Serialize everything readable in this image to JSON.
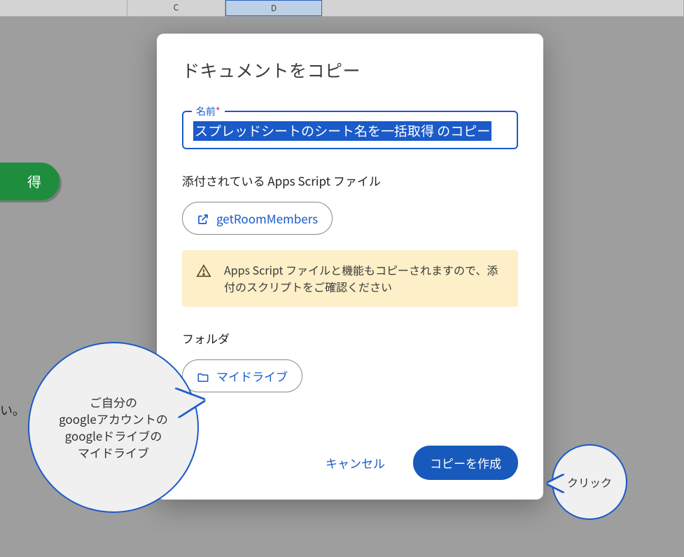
{
  "columns": {
    "c": "C",
    "d": "D"
  },
  "green_button_label": "得",
  "trail_text": "い。",
  "dialog": {
    "title": "ドキュメントをコピー",
    "name_label": "名前",
    "name_required_mark": "*",
    "name_value": "スプレッドシートのシート名を一括取得 のコピー",
    "apps_script_label": "添付されている Apps Script ファイル",
    "script_chip": "getRoomMembers",
    "warning_text": "Apps Script ファイルと機能もコピーされますので、添付のスクリプトをご確認ください",
    "folder_label": "フォルダ",
    "folder_chip": "マイドライブ",
    "cancel_label": "キャンセル",
    "create_label": "コピーを作成"
  },
  "callouts": {
    "left_line1": "ご自分の",
    "left_line2": "googleアカウントの",
    "left_line3": "googleドライブの",
    "left_line4": "マイドライブ",
    "right": "クリック"
  }
}
